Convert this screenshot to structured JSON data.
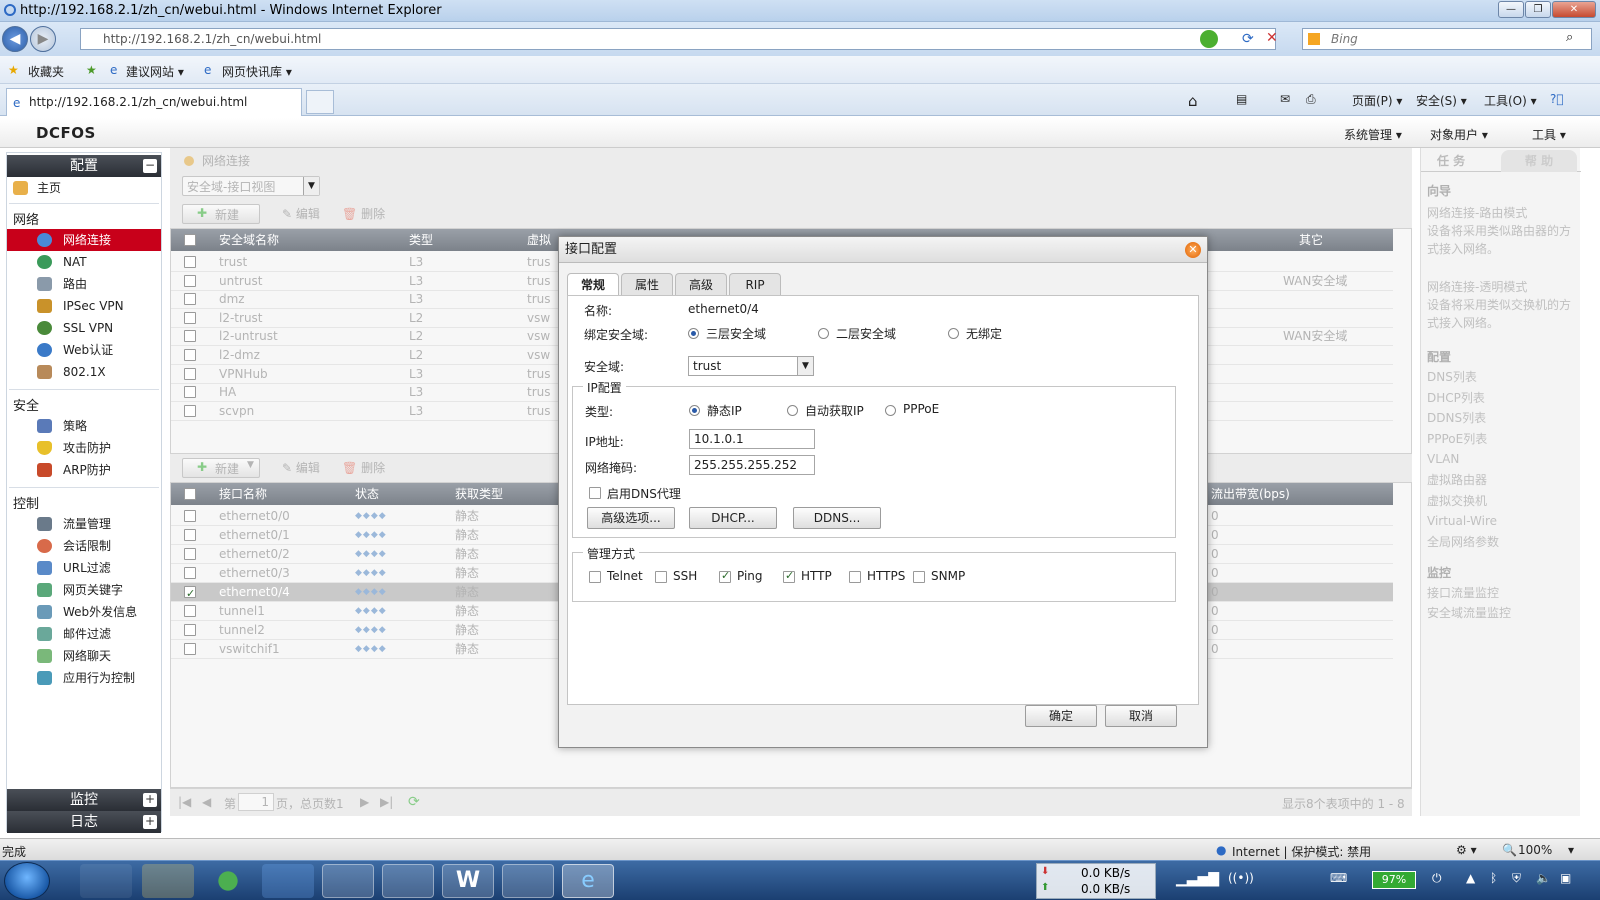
{
  "browser": {
    "title": "http://192.168.2.1/zh_cn/webui.html - Windows Internet Explorer",
    "url": "http://192.168.2.1/zh_cn/webui.html",
    "search_placeholder": "Bing",
    "favorites": "收藏夹",
    "fav_items": [
      "建议网站 ▾",
      "网页快讯库 ▾"
    ],
    "tab_title": "http://192.168.2.1/zh_cn/webui.html",
    "tools": [
      "页面(P) ▾",
      "安全(S) ▾",
      "工具(O) ▾"
    ]
  },
  "app": {
    "logo": "DCFOS",
    "menus": [
      "系统管理 ▾",
      "对象用户 ▾",
      "工具 ▾"
    ]
  },
  "nav": {
    "config_header": "配置",
    "home": "主页",
    "sections": [
      {
        "title": "网络",
        "items": [
          "网络连接",
          "NAT",
          "路由",
          "IPSec VPN",
          "SSL VPN",
          "Web认证",
          "802.1X"
        ]
      },
      {
        "title": "安全",
        "items": [
          "策略",
          "攻击防护",
          "ARP防护"
        ]
      },
      {
        "title": "控制",
        "items": [
          "流量管理",
          "会话限制",
          "URL过滤",
          "网页关键字",
          "Web外发信息",
          "邮件过滤",
          "网络聊天",
          "应用行为控制"
        ]
      }
    ],
    "monitor_header": "监控",
    "log_header": "日志",
    "selected": "网络连接"
  },
  "main": {
    "breadcrumb": "网络连接",
    "view_select": "安全域-接口视图",
    "toolbar1": {
      "new": "新建",
      "edit": "编辑",
      "delete": "删除"
    },
    "zone_table": {
      "headers": [
        "安全域名称",
        "类型",
        "虚拟",
        "其它"
      ],
      "rows": [
        {
          "name": "trust",
          "type": "L3",
          "v": "trus",
          "other": ""
        },
        {
          "name": "untrust",
          "type": "L3",
          "v": "trus",
          "other": "WAN安全域"
        },
        {
          "name": "dmz",
          "type": "L3",
          "v": "trus",
          "other": ""
        },
        {
          "name": "l2-trust",
          "type": "L2",
          "v": "vsw",
          "other": ""
        },
        {
          "name": "l2-untrust",
          "type": "L2",
          "v": "vsw",
          "other": "WAN安全域"
        },
        {
          "name": "l2-dmz",
          "type": "L2",
          "v": "vsw",
          "other": ""
        },
        {
          "name": "VPNHub",
          "type": "L3",
          "v": "trus",
          "other": ""
        },
        {
          "name": "HA",
          "type": "L3",
          "v": "trus",
          "other": ""
        },
        {
          "name": "scvpn",
          "type": "L3",
          "v": "trus",
          "other": ""
        }
      ]
    },
    "toolbar2": {
      "new": "新建",
      "edit": "编辑",
      "delete": "删除"
    },
    "iface_table": {
      "headers": [
        "接口名称",
        "状态",
        "获取类型",
        "流出带宽(bps)"
      ],
      "rows": [
        {
          "name": "ethernet0/0",
          "get": "静态",
          "bw": "0",
          "checked": false
        },
        {
          "name": "ethernet0/1",
          "get": "静态",
          "bw": "0",
          "checked": false
        },
        {
          "name": "ethernet0/2",
          "get": "静态",
          "bw": "0",
          "checked": false
        },
        {
          "name": "ethernet0/3",
          "get": "静态",
          "bw": "0",
          "checked": false
        },
        {
          "name": "ethernet0/4",
          "get": "静态",
          "bw": "0",
          "checked": true
        },
        {
          "name": "tunnel1",
          "get": "静态",
          "bw": "0",
          "checked": false
        },
        {
          "name": "tunnel2",
          "get": "静态",
          "bw": "0",
          "checked": false
        },
        {
          "name": "vswitchif1",
          "get": "静态",
          "bw": "0",
          "checked": false
        }
      ]
    },
    "pager": {
      "page_prefix": "第",
      "page": "1",
      "page_suffix": "页，总页数1",
      "summary": "显示8个表项中的 1 - 8"
    }
  },
  "rpanel": {
    "tabs": [
      "任 务",
      "帮 助"
    ],
    "guide_header": "向导",
    "guide_items": [
      "网络连接-路由模式",
      "设备将采用类似路由器的方式接入网络。",
      "网络连接-透明模式",
      "设备将采用类似交换机的方式接入网络。"
    ],
    "config_header": "配置",
    "config_items": [
      "DNS列表",
      "DHCP列表",
      "DDNS列表",
      "PPPoE列表",
      "VLAN",
      "虚拟路由器",
      "虚拟交换机",
      "Virtual-Wire",
      "全局网络参数"
    ],
    "monitor_header": "监控",
    "monitor_items": [
      "接口流量监控",
      "安全域流量监控"
    ]
  },
  "dialog": {
    "title": "接口配置",
    "tabs": [
      "常规",
      "属性",
      "高级",
      "RIP"
    ],
    "name_label": "名称:",
    "name_value": "ethernet0/4",
    "bind_label": "绑定安全域:",
    "bind_options": [
      "三层安全域",
      "二层安全域",
      "无绑定"
    ],
    "zone_label": "安全域:",
    "zone_value": "trust",
    "ip_legend": "IP配置",
    "type_label": "类型:",
    "type_options": [
      "静态IP",
      "自动获取IP",
      "PPPoE"
    ],
    "ip_label": "IP地址:",
    "ip_value": "10.1.0.1",
    "mask_label": "网络掩码:",
    "mask_value": "255.255.255.252",
    "dns_proxy": "启用DNS代理",
    "btn_adv": "高级选项...",
    "btn_dhcp": "DHCP...",
    "btn_ddns": "DDNS...",
    "mgmt_legend": "管理方式",
    "mgmt_options": [
      {
        "label": "Telnet",
        "checked": false
      },
      {
        "label": "SSH",
        "checked": false
      },
      {
        "label": "Ping",
        "checked": true
      },
      {
        "label": "HTTP",
        "checked": true
      },
      {
        "label": "HTTPS",
        "checked": false
      },
      {
        "label": "SNMP",
        "checked": false
      }
    ],
    "ok": "确定",
    "cancel": "取消"
  },
  "status": {
    "left": "完成",
    "zone": "Internet | 保护模式: 禁用",
    "zoom": "100%"
  },
  "taskbar": {
    "down": "0.0 KB/s",
    "up": "0.0 KB/s",
    "battery": "97%"
  }
}
